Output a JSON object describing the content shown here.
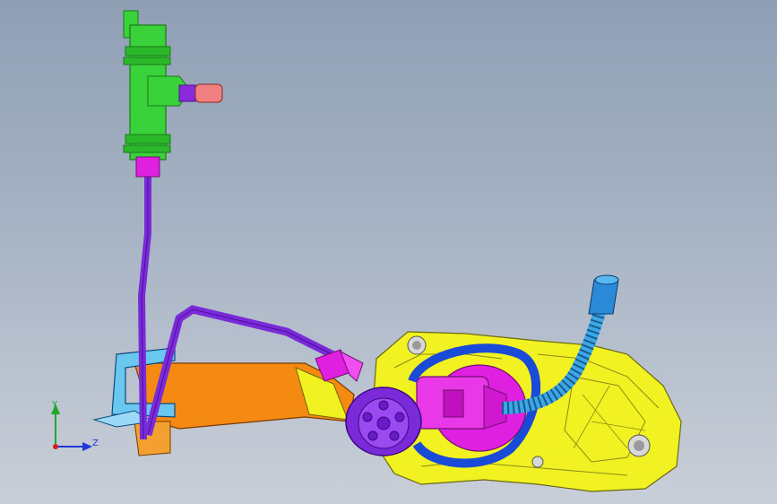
{
  "viewport": {
    "background_top": "#8f9fb4",
    "background_bottom": "#c9cfd8"
  },
  "triad": {
    "y_label": "Y",
    "z_label": "Z",
    "colors": {
      "y": "#1fa82a",
      "z": "#1f3ad8",
      "origin": "#d81f1f"
    }
  },
  "model_colors": {
    "valve": "#3ad23a",
    "valve_dark": "#1b7a1b",
    "magenta": "#e020e0",
    "purple": "#7a2ad8",
    "purple_dark": "#4a109a",
    "orange": "#f48a12",
    "yellow": "#f2f222",
    "blue": "#1a4ad8",
    "light_blue": "#3aa8e8",
    "pink": "#f08080"
  }
}
